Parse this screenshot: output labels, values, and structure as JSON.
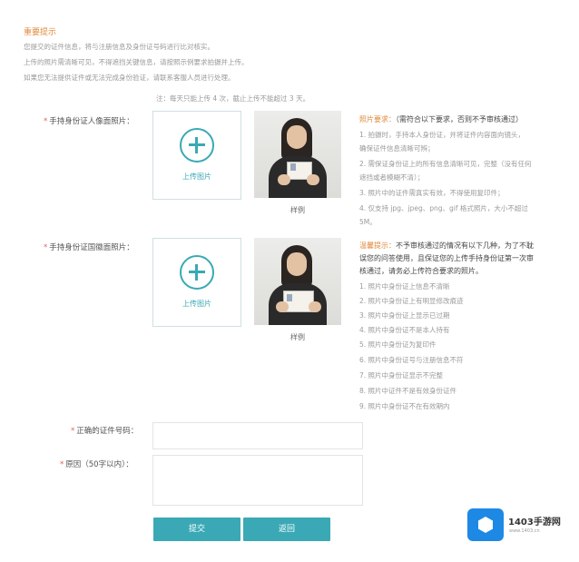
{
  "notice": {
    "title": "重要提示",
    "lines": [
      "您提交的证件信息，将与注册信息及身份证号码进行比对核实。",
      "上传的照片需清晰可见，不得遮挡关键信息，请按照示例要求拍摄并上传。",
      "如果您无法提供证件或无法完成身份验证，请联系客服人员进行处理。"
    ]
  },
  "limit_text": "注：每天只能上传 4 次，截止上传不能超过 3 天。",
  "front": {
    "label": "手持身份证人像面照片：",
    "upload_label": "上传图片",
    "sample_caption": "样例"
  },
  "back": {
    "label": "手持身份证国徽面照片：",
    "upload_label": "上传图片",
    "sample_caption": "样例"
  },
  "requirements": {
    "head": "照片要求：",
    "head_note": "（需符合以下要求，否则不予审核通过）",
    "lines": [
      "1. 拍摄时，手持本人身份证，并将证件内容面向镜头，",
      "   确保证件信息清晰可辨；",
      "2. 需保证身份证上的所有信息清晰可见，完整（没有任何",
      "   遮挡或者模糊不清）；",
      "3. 照片中的证件需真实有效，不得使用复印件；",
      "4. 仅支持 jpg、jpeg、png、gif 格式照片，大小不超过",
      "   5M。"
    ]
  },
  "reasons": {
    "head": "温馨提示：",
    "head_rest": "不予审核通过的情况有以下几种，为了不耽",
    "more_lines": [
      "误您的问答使用，且保证您的上传手持身份证第一次审",
      "核通过，请务必上传符合要求的照片。"
    ],
    "items": [
      "1. 照片中身份证上信息不清晰",
      "2. 照片中身份证上有明显修改痕迹",
      "3. 照片中身份证上显示已过期",
      "4. 照片中身份证不是本人持有",
      "5. 照片中身份证为复印件",
      "6. 照片中身份证号与注册信息不符",
      "7. 照片中身份证显示不完整",
      "8. 照片中证件不是有效身份证件",
      "9. 照片中身份证不在有效期内"
    ]
  },
  "id_field": {
    "label": "正确的证件号码：",
    "value": ""
  },
  "reason_field": {
    "label": "原因（50字以内）：",
    "value": ""
  },
  "buttons": {
    "submit": "提交",
    "back": "返回"
  },
  "watermark": {
    "brand": "1403手游网",
    "url": "www.1403.cn"
  },
  "colors": {
    "accent": "#3aa9b5",
    "notice": "#e08a3a",
    "watermark": "#1e88e5"
  }
}
